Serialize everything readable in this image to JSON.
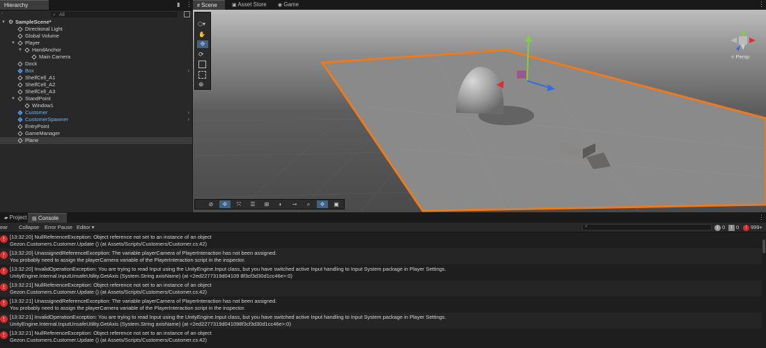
{
  "hierarchy": {
    "tab_label": "Hierarchy",
    "search_placeholder": "All",
    "items": [
      {
        "label": "SampleScene*"
      },
      {
        "label": "Directional Light"
      },
      {
        "label": "Global Volume"
      },
      {
        "label": "Player"
      },
      {
        "label": "HandAnchor"
      },
      {
        "label": "Main Camera"
      },
      {
        "label": "Dock"
      },
      {
        "label": "Box"
      },
      {
        "label": "ShelfCell_A1"
      },
      {
        "label": "ShelfCell_A2"
      },
      {
        "label": "ShelfCell_A3"
      },
      {
        "label": "StandPoint"
      },
      {
        "label": "Window1"
      },
      {
        "label": "Customer"
      },
      {
        "label": "CustomerSpawner"
      },
      {
        "label": "EntryPoint"
      },
      {
        "label": "GameManager"
      },
      {
        "label": "Plane"
      }
    ]
  },
  "scene": {
    "tabs": [
      {
        "label": "Scene"
      },
      {
        "label": "Asset Store"
      },
      {
        "label": "Game"
      }
    ],
    "projection_label": "< Persp"
  },
  "bottom": {
    "tabs": [
      {
        "label": "Project"
      },
      {
        "label": "Console"
      }
    ],
    "toolbar": {
      "clear": "ear",
      "collapse": "Collapse",
      "error_pause": "Error Pause",
      "editor": "Editor ▾"
    },
    "counts": {
      "info": "0",
      "warnings": "0",
      "errors": "999+"
    },
    "logs": [
      {
        "line1": "[13:32:20] NullReferenceException: Object reference not set to an instance of an object",
        "line2": "Gezon.Customers.Customer.Update () (at Assets/Scripts/Customers/Customer.cs:42)"
      },
      {
        "line1": "[13:32:20] UnassignedReferenceException: The variable playerCamera of PlayerInteraction has not been assigned.",
        "line2": "You probably need to assign the playerCamera variable of the PlayerInteraction script in the inspector."
      },
      {
        "line1": "[13:32:20] InvalidOperationException: You are trying to read Input using the UnityEngine.Input class, but you have switched active Input handling to Input System package in Player Settings.",
        "line2": "UnityEngine.Internal.InputUnsafeUtility.GetAxis (System.String axisName) (at <2ed2277319d04109 8f3cf3d30d1cc46e>:0)"
      },
      {
        "line1": "[13:32:21] NullReferenceException: Object reference not set to an instance of an object",
        "line2": "Gezon.Customers.Customer.Update () (at Assets/Scripts/Customers/Customer.cs:42)"
      },
      {
        "line1": "[13:32:21] UnassignedReferenceException: The variable playerCamera of PlayerInteraction has not been assigned.",
        "line2": "You probably need to assign the playerCamera variable of the PlayerInteraction script in the inspector."
      },
      {
        "line1": "[13:32:21] InvalidOperationException: You are trying to read Input using the UnityEngine.Input class, but you have switched active Input handling to Input System package in Player Settings.",
        "line2": "UnityEngine.Internal.InputUnsafeUtility.GetAxis (System.String axisName) (at <2ed2277319d041098f3cf3d30d1cc46e>:0)"
      },
      {
        "line1": "[13:32:21] NullReferenceException: Object reference not set to an instance of an object",
        "line2": "Gezon.Customers.Customer.Update () (at Assets/Scripts/Customers/Customer.cs:42)"
      }
    ]
  },
  "colors": {
    "selection_orange": "#f07a1a",
    "prefab_blue": "#6fb3f3",
    "error_red": "#d92b2b"
  }
}
